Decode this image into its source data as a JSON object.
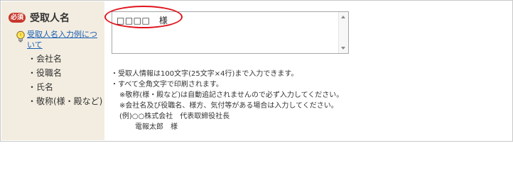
{
  "label": {
    "badge": "必須",
    "title": "受取人名",
    "help_link": "受取人名入力例について",
    "items": [
      "・会社名",
      "・役職名",
      "・氏名",
      "・敬称(様・殿など)"
    ]
  },
  "recipient_input": {
    "value": "□□□□　様"
  },
  "notes": [
    "・受取人情報は100文字(25文字×4行)まで入力できます。",
    "・すべて全角文字で印刷されます。",
    "※敬称(様・殿など)は自動追記されませんので必ず入力してください。",
    "※会社名及び役職名、様方、気付等がある場合は入力してください。",
    "(例)○○株式会社　代表取締役社長",
    "電報太郎　様"
  ],
  "colors": {
    "label_bg": "#f3ede1",
    "badge": "#c8372d",
    "link": "#1a5fb4",
    "highlight": "#e0141e"
  }
}
